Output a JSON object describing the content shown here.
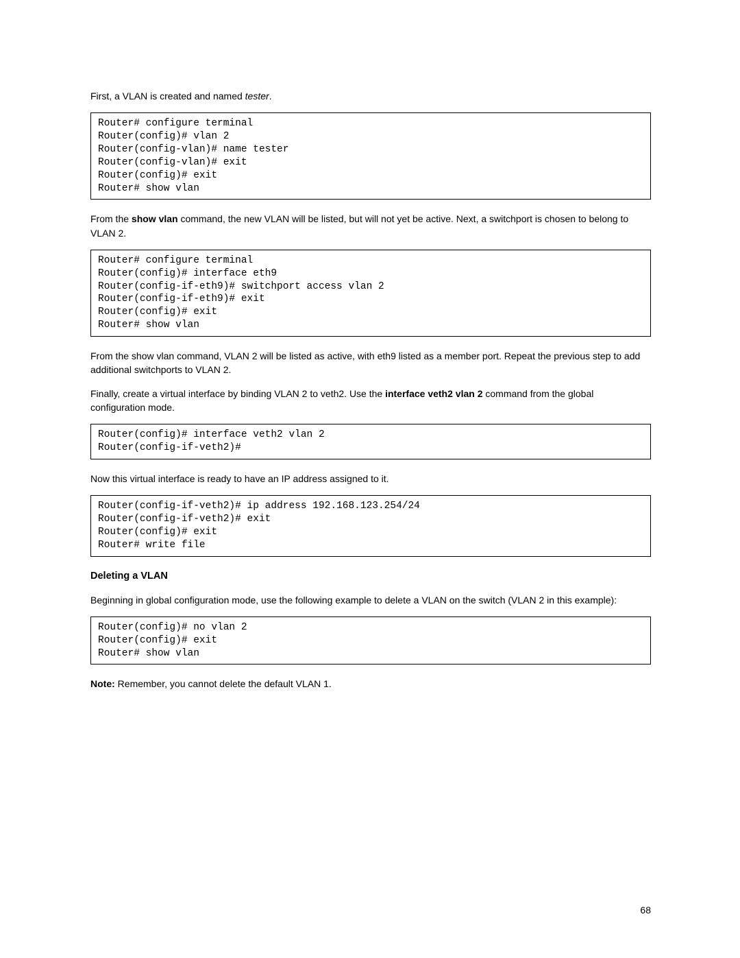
{
  "p1_a": "First, a VLAN is created and named ",
  "p1_b": "tester",
  "p1_c": ".",
  "code1": "Router# configure terminal\nRouter(config)# vlan 2\nRouter(config-vlan)# name tester\nRouter(config-vlan)# exit\nRouter(config)# exit\nRouter# show vlan",
  "p2_a": "From the ",
  "p2_b": "show vlan",
  "p2_c": " command, the new VLAN will be listed, but will not yet be active. Next, a switchport is chosen to belong to VLAN 2.",
  "code2": "Router# configure terminal\nRouter(config)# interface eth9\nRouter(config-if-eth9)# switchport access vlan 2\nRouter(config-if-eth9)# exit\nRouter(config)# exit\nRouter# show vlan",
  "p3": "From the show vlan command, VLAN 2 will be listed as active, with eth9 listed as a member port. Repeat the previous step to add additional switchports to VLAN 2.",
  "p4_a": "Finally, create a virtual interface by binding VLAN 2 to veth2. Use the ",
  "p4_b": "interface veth2 vlan 2",
  "p4_c": " command from the global configuration mode.",
  "code3": "Router(config)# interface veth2 vlan 2\nRouter(config-if-veth2)#",
  "p5": "Now this virtual interface is ready to have an IP address assigned to it.",
  "code4": "Router(config-if-veth2)# ip address 192.168.123.254/24\nRouter(config-if-veth2)# exit\nRouter(config)# exit\nRouter# write file",
  "heading1": "Deleting a VLAN",
  "p6": "Beginning in global configuration mode, use the following example to delete a VLAN on the switch (VLAN 2 in this example):",
  "code5": "Router(config)# no vlan 2\nRouter(config)# exit\nRouter# show vlan",
  "p7_a": "Note:",
  "p7_b": " Remember, you cannot delete the default VLAN 1.",
  "page_number": "68"
}
